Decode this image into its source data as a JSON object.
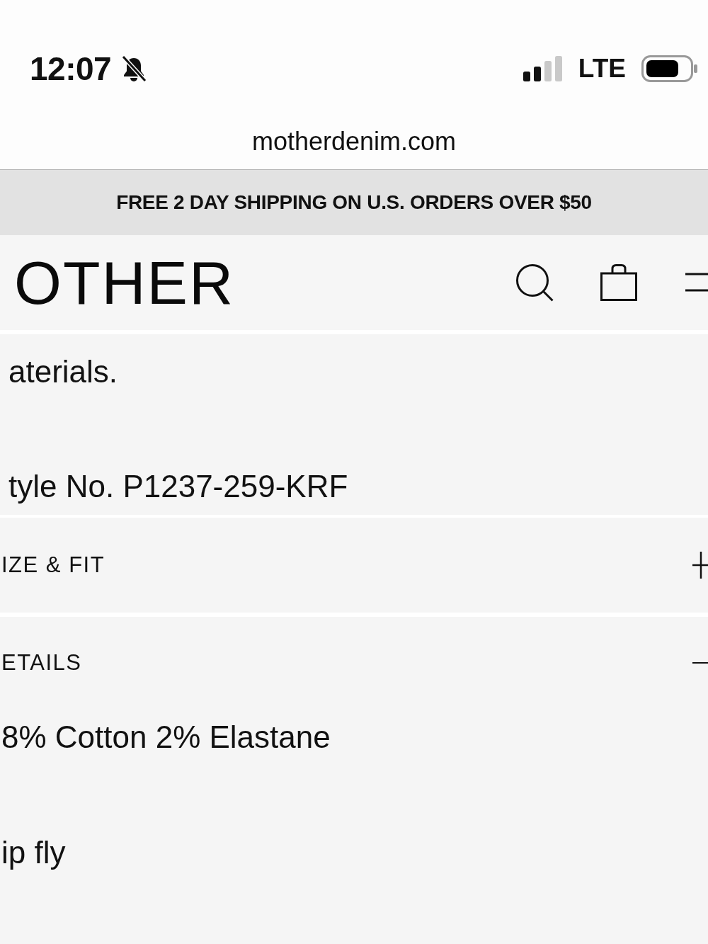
{
  "status_bar": {
    "time": "12:07",
    "network": "LTE"
  },
  "address_bar": {
    "url": "motherdenim.com"
  },
  "promo_banner": {
    "text": "FREE 2 DAY SHIPPING ON U.S. ORDERS OVER $50"
  },
  "header": {
    "logo": "OTHER"
  },
  "description": {
    "paragraphs": [
      "aterials.",
      "tyle No. P1237-259-KRF"
    ]
  },
  "accordion": [
    {
      "title": "IZE & FIT",
      "expanded": false
    },
    {
      "title": "ETAILS",
      "expanded": true,
      "items": [
        "8% Cotton 2% Elastane",
        "ip fly"
      ]
    }
  ]
}
